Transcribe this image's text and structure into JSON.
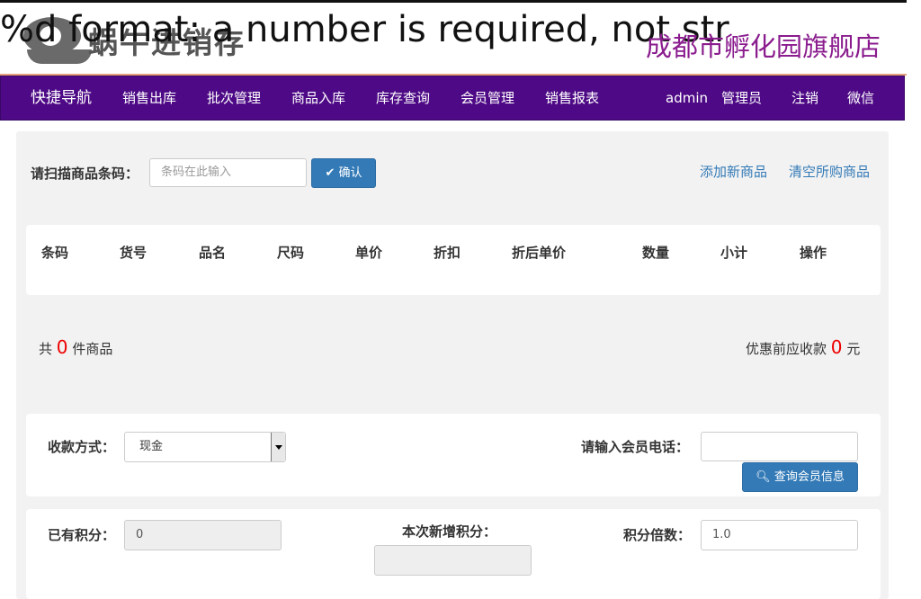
{
  "header": {
    "logo_text": "蜗牛进销存",
    "error_text": "%d format: a number is required, not str",
    "store_name": "成都市孵化园旗舰店"
  },
  "nav": {
    "brand": "快捷导航",
    "items": [
      "销售出库",
      "批次管理",
      "商品入库",
      "库存查询",
      "会员管理",
      "销售报表"
    ],
    "user": "admin",
    "role": "管理员",
    "logout": "注销",
    "wechat": "微信"
  },
  "scan": {
    "label": "请扫描商品条码：",
    "placeholder": "条码在此输入",
    "confirm_label": "确认",
    "confirm_icon": "check-icon",
    "add_new_link": "添加新商品",
    "clear_link": "清空所购商品"
  },
  "table": {
    "columns": [
      "条码",
      "货号",
      "品名",
      "尺码",
      "单价",
      "折扣",
      "折后单价",
      "数量",
      "小计",
      "操作"
    ],
    "rows": []
  },
  "summary": {
    "count_prefix": "共",
    "count": "0",
    "count_suffix": "件商品",
    "total_prefix": "优惠前应收款",
    "total": "0",
    "total_suffix": "元"
  },
  "payment": {
    "method_label": "收款方式：",
    "method_value": "现金",
    "member_phone_label": "请输入会员电话：",
    "member_phone_value": "",
    "query_member_label": "查询会员信息",
    "query_icon": "search-icon"
  },
  "points": {
    "existing_label": "已有积分：",
    "existing_value": "0",
    "new_label": "本次新增积分：",
    "new_value": "",
    "multiplier_label": "积分倍数：",
    "multiplier_value": "1.0"
  },
  "colors": {
    "nav_bg": "#4e0a86",
    "store_name": "#8a1c8e",
    "primary": "#337ab7",
    "highlight": "#ee0000"
  }
}
